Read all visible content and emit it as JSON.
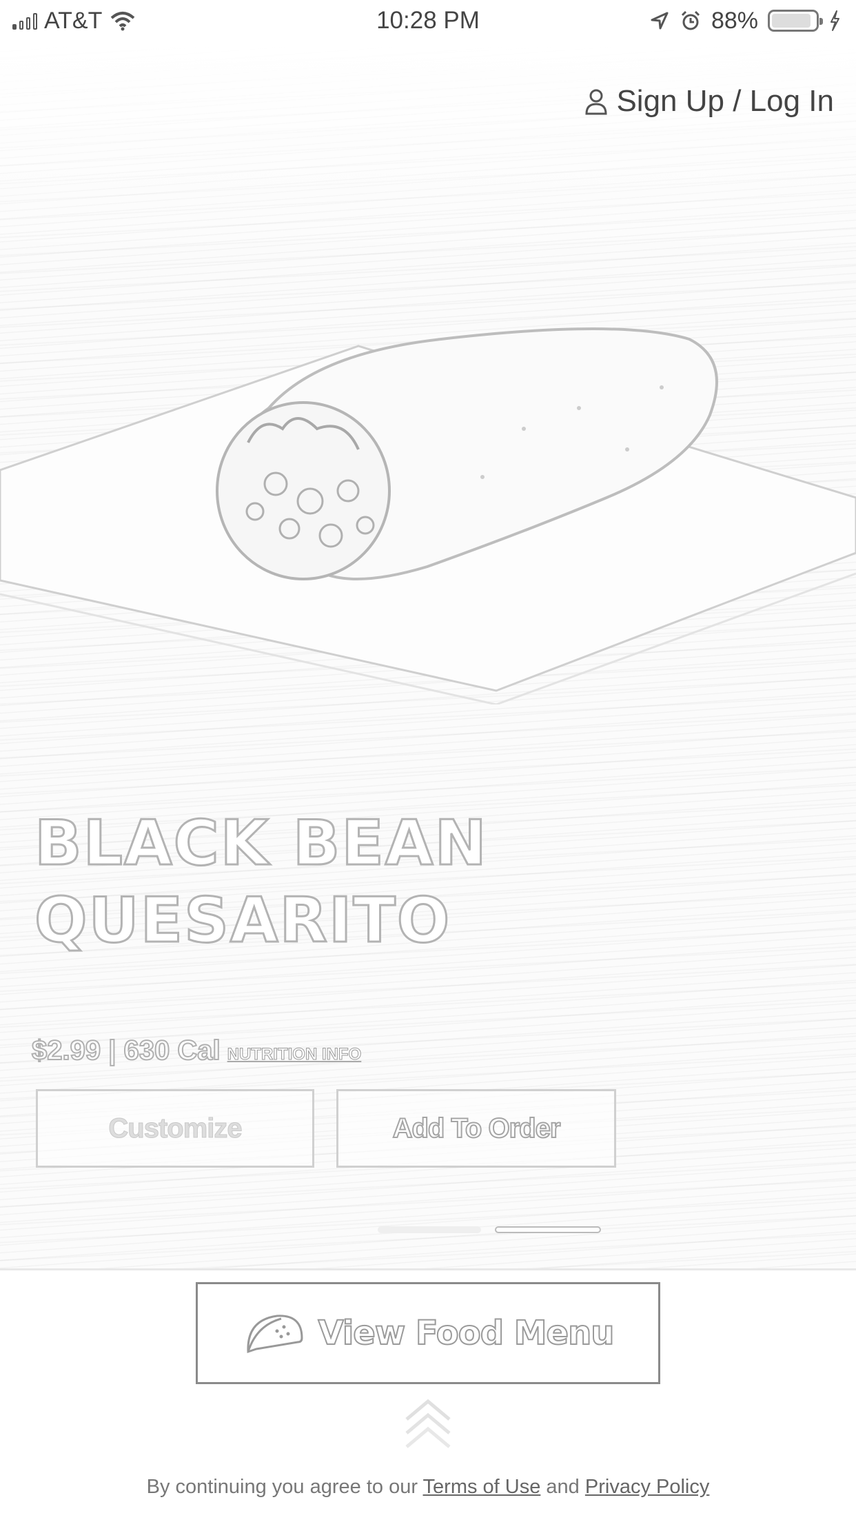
{
  "status_bar": {
    "carrier": "AT&T",
    "time": "10:28 PM",
    "battery": "88%",
    "icons": [
      "signal-icon",
      "wifi-icon",
      "location-icon",
      "alarm-icon",
      "battery-icon",
      "charging-icon"
    ]
  },
  "header": {
    "signin_label": "Sign Up / Log In",
    "signin_icon": "user-icon"
  },
  "product": {
    "title": "BLACK BEAN QUESARITO",
    "price_line": "$2.99 | 630 Cal",
    "nutrition_link": "NUTRITION INFO",
    "image": "burrito-photo"
  },
  "actions": {
    "customize_label": "Customize",
    "add_label": "Add To Order"
  },
  "carousel": {
    "page_count": 2,
    "active_page": 2
  },
  "menu": {
    "button_label": "View Food Menu",
    "icon": "taco-icon"
  },
  "legal": {
    "prefix": "By continuing you agree to our",
    "terms": "Terms of Use",
    "and": "and",
    "privacy": "Privacy Policy"
  }
}
